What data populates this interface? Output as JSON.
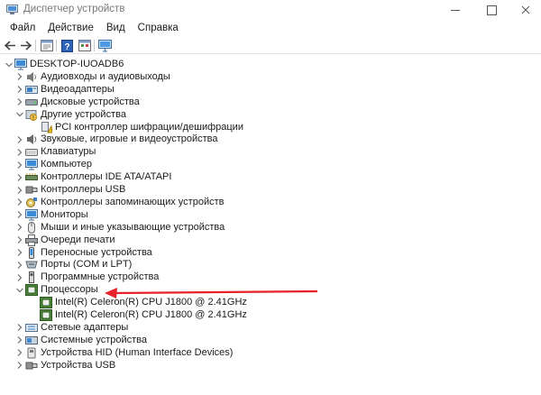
{
  "window": {
    "title": "Диспетчер устройств"
  },
  "menu": [
    "Файл",
    "Действие",
    "Вид",
    "Справка"
  ],
  "toolbar": [
    "back-icon",
    "forward-icon",
    "properties-icon",
    "help-icon",
    "view-icon",
    "monitor-scan-icon"
  ],
  "tree": {
    "root": "DESKTOP-IUOADB6",
    "items": [
      {
        "label": "Аудиовходы и аудиовыходы",
        "icon": "audio-icon",
        "expanded": false
      },
      {
        "label": "Видеоадаптеры",
        "icon": "display-adapter-icon",
        "expanded": false
      },
      {
        "label": "Дисковые устройства",
        "icon": "disk-icon",
        "expanded": false
      },
      {
        "label": "Другие устройства",
        "icon": "other-devices-icon",
        "expanded": true,
        "children": [
          {
            "label": "PCI контроллер шифрации/дешифрации",
            "icon": "unknown-device-icon"
          }
        ]
      },
      {
        "label": "Звуковые, игровые и видеоустройства",
        "icon": "sound-icon",
        "expanded": false
      },
      {
        "label": "Клавиатуры",
        "icon": "keyboard-icon",
        "expanded": false
      },
      {
        "label": "Компьютер",
        "icon": "computer-icon",
        "expanded": false
      },
      {
        "label": "Контроллеры IDE ATA/ATAPI",
        "icon": "ide-controller-icon",
        "expanded": false
      },
      {
        "label": "Контроллеры USB",
        "icon": "usb-controller-icon",
        "expanded": false
      },
      {
        "label": "Контроллеры запоминающих устройств",
        "icon": "storage-controller-icon",
        "expanded": false
      },
      {
        "label": "Мониторы",
        "icon": "monitor-icon",
        "expanded": false
      },
      {
        "label": "Мыши и иные указывающие устройства",
        "icon": "mouse-icon",
        "expanded": false
      },
      {
        "label": "Очереди печати",
        "icon": "printer-icon",
        "expanded": false
      },
      {
        "label": "Переносные устройства",
        "icon": "portable-device-icon",
        "expanded": false
      },
      {
        "label": "Порты (COM и LPT)",
        "icon": "port-icon",
        "expanded": false
      },
      {
        "label": "Программные устройства",
        "icon": "software-device-icon",
        "expanded": false
      },
      {
        "label": "Процессоры",
        "icon": "processor-icon",
        "expanded": true,
        "children": [
          {
            "label": "Intel(R) Celeron(R) CPU  J1800  @ 2.41GHz",
            "icon": "processor-icon"
          },
          {
            "label": "Intel(R) Celeron(R) CPU  J1800  @ 2.41GHz",
            "icon": "processor-icon"
          }
        ]
      },
      {
        "label": "Сетевые адаптеры",
        "icon": "network-adapter-icon",
        "expanded": false
      },
      {
        "label": "Системные устройства",
        "icon": "system-device-icon",
        "expanded": false
      },
      {
        "label": "Устройства HID (Human Interface Devices)",
        "icon": "hid-icon",
        "expanded": false
      },
      {
        "label": "Устройства USB",
        "icon": "usb-device-icon",
        "expanded": false
      }
    ]
  },
  "annotation": {
    "icon": "red-arrow-icon",
    "color": "#e8202a"
  },
  "colors": {
    "accent": "#2a7bd6",
    "chevron": "#6d6d6d",
    "processor": "#4d8a3a"
  }
}
